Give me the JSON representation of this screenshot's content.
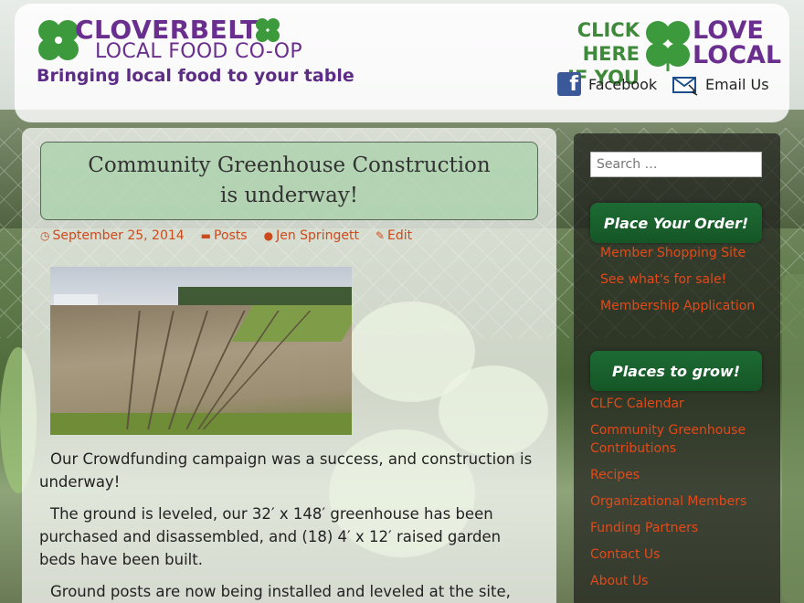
{
  "header": {
    "logo_title": "CLOVERBELT",
    "logo_subtitle": "LOCAL FOOD CO-OP",
    "tagline": "Bringing local food to your table",
    "click_here_line1": "CLICK HERE",
    "click_here_line2": "IF YOU",
    "love_line1": "LOVE",
    "love_line2": "LOCAL",
    "facebook_label": "Facebook",
    "email_label": "Email Us",
    "colors": {
      "purple": "#6a2f8e",
      "green": "#3f8a3a"
    }
  },
  "post": {
    "title": "Community Greenhouse Construction is underway!",
    "date": "September 25, 2014",
    "category": "Posts",
    "author": "Jen Springett",
    "edit_label": "Edit",
    "paragraphs": [
      "Our Crowdfunding campaign was a success, and construction is underway!",
      "The ground is leveled, our 32′ x 148′ greenhouse has been purchased and disassembled, and (18) 4′ x 12′ raised garden beds have been built.",
      "Ground posts are now being installed and leveled at the site,"
    ]
  },
  "sidebar": {
    "search_placeholder": "Search …",
    "order_title": "Place Your Order!",
    "order_links": [
      "Member Shopping Site",
      "See what's for sale!",
      "Membership Application"
    ],
    "grow_title": "Places to grow!",
    "grow_links": [
      "CLFC Calendar",
      "Community Greenhouse Contributions",
      "Recipes",
      "Organizational Members",
      "Funding Partners",
      "Contact Us",
      "About Us"
    ],
    "link_color": "#e24a1a"
  }
}
